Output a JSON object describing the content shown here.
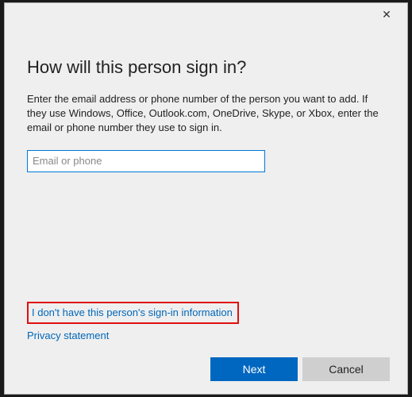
{
  "dialog": {
    "heading": "How will this person sign in?",
    "description": "Enter the email address or phone number of the person you want to add. If they use Windows, Office, Outlook.com, OneDrive, Skype, or Xbox, enter the email or phone number they use to sign in.",
    "input_placeholder": "Email or phone",
    "input_value": "",
    "link_no_info": "I don't have this person's sign-in information",
    "link_privacy": "Privacy statement",
    "button_next": "Next",
    "button_cancel": "Cancel"
  }
}
